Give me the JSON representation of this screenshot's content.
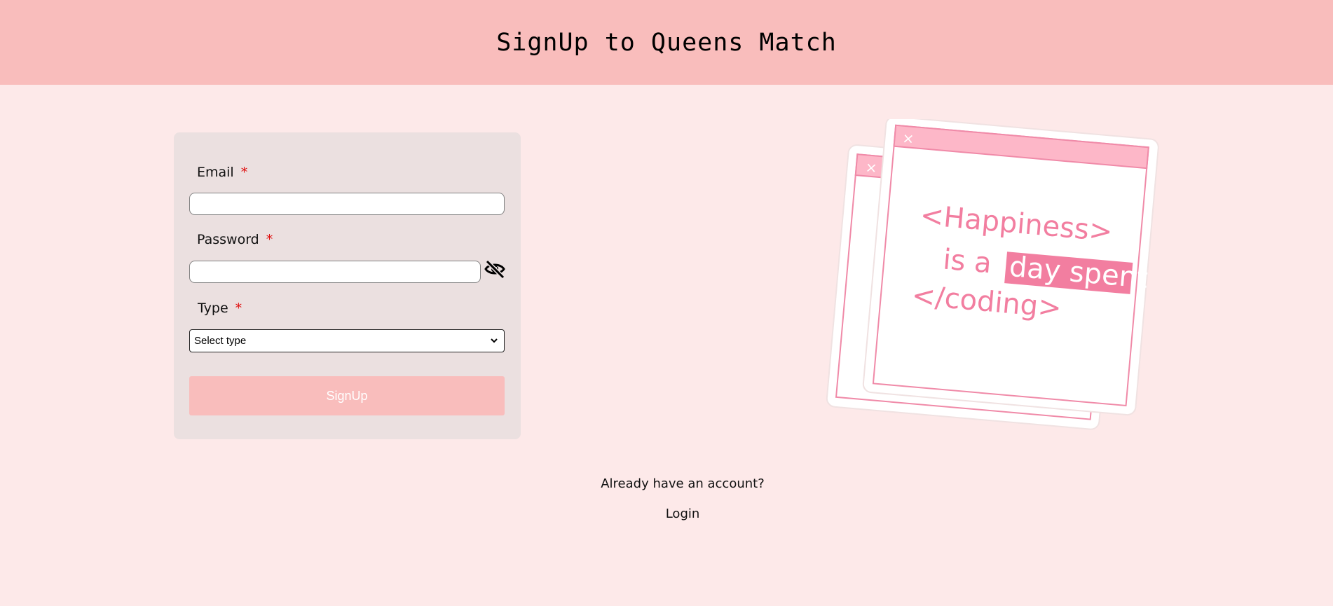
{
  "header": {
    "title": "SignUp to Queens Match"
  },
  "form": {
    "email_label": "Email",
    "password_label": "Password",
    "type_label": "Type",
    "required_mark": "*",
    "email_value": "",
    "password_value": "",
    "type_selected": "Select type",
    "submit_label": "SignUp"
  },
  "icons": {
    "password_toggle": "eye-slash-icon",
    "select_caret": "chevron-down-icon"
  },
  "footer": {
    "question": "Already have an account?",
    "login_label": "Login"
  },
  "illustration": {
    "line1": "<Happiness>",
    "line2_prefix": "is a",
    "line2_highlight": "day spent",
    "line3": "</coding>",
    "close_glyph": "×"
  },
  "colors": {
    "header_bg": "#f9bdbc",
    "page_bg": "#fde9e9",
    "card_bg": "#ebe0e0",
    "accent_pink": "#f27ea0",
    "required_red": "#e01010"
  }
}
